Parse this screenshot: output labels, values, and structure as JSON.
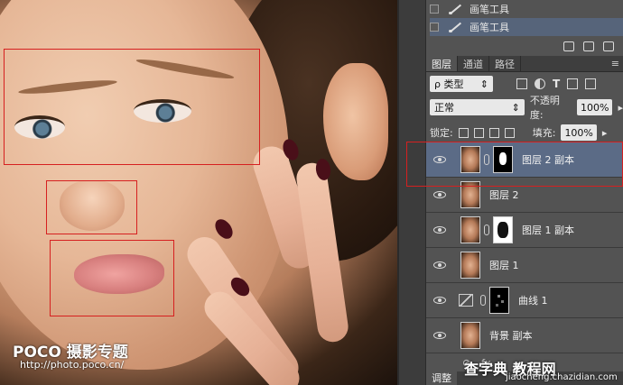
{
  "history": {
    "items": [
      {
        "label": "画笔工具",
        "selected": false
      },
      {
        "label": "画笔工具",
        "selected": true
      }
    ]
  },
  "tabs": [
    "图层",
    "通道",
    "路径"
  ],
  "tab_menu": "≡",
  "filter": {
    "kind": "ρ 类型",
    "arrow": "⇕"
  },
  "blend": {
    "mode": "正常",
    "arrow": "⇕",
    "opacity_label": "不透明度:",
    "opacity": "100%",
    "arrow2": "▸"
  },
  "lock": {
    "label": "锁定:",
    "fill_label": "填充:",
    "fill": "100%",
    "arrow2": "▸"
  },
  "layers": [
    {
      "name": "图层 2 副本",
      "mask": "dark",
      "selected": true
    },
    {
      "name": "图层 2",
      "mask": null,
      "selected": false
    },
    {
      "name": "图层 1 副本",
      "mask": "white",
      "selected": false
    },
    {
      "name": "图层 1",
      "mask": null,
      "selected": false
    },
    {
      "name": "曲线 1",
      "mask": "curve",
      "selected": false,
      "adjustment": true
    },
    {
      "name": "背景 副本",
      "mask": null,
      "selected": false
    }
  ],
  "bottom": {
    "link": "⊘",
    "fx": "fx."
  },
  "adjust_tab": "调整",
  "watermark": {
    "brand": "POCO 摄影专题",
    "url": "http://photo.poco.cn/"
  },
  "site": {
    "name": "查字典 教程网",
    "url": "jiaocheng.chazidian.com"
  },
  "colors": {
    "selection": "#5b6b86",
    "annotation": "#d62020"
  }
}
